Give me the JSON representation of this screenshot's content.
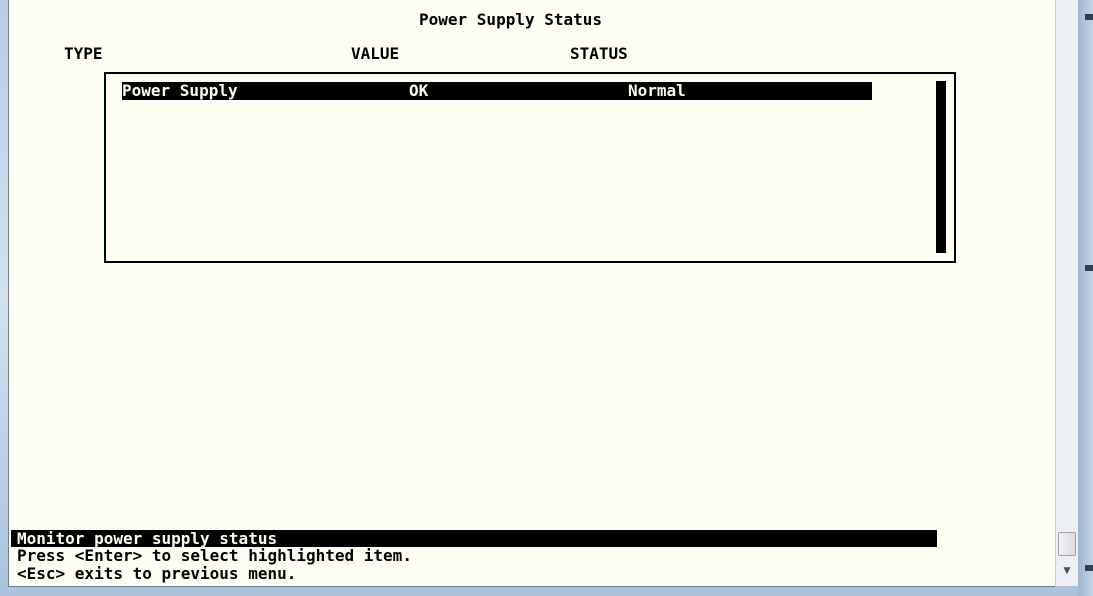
{
  "screen": {
    "title": "Power Supply Status",
    "columns": {
      "type": "TYPE",
      "value": "VALUE",
      "status": "STATUS"
    },
    "rows": [
      {
        "type": "Power Supply",
        "value": "OK",
        "status": "Normal",
        "highlighted": true
      }
    ],
    "status_line": "Monitor power supply status",
    "help": [
      "Press <Enter> to select highlighted item.",
      "<Esc> exits to previous menu."
    ]
  },
  "window": {
    "scrollbar_down_icon": "arrow-down",
    "colors": {
      "background": "#fdfdf2",
      "text": "#000000",
      "highlight_bg": "#000000",
      "highlight_fg": "#fdfdf2"
    }
  }
}
